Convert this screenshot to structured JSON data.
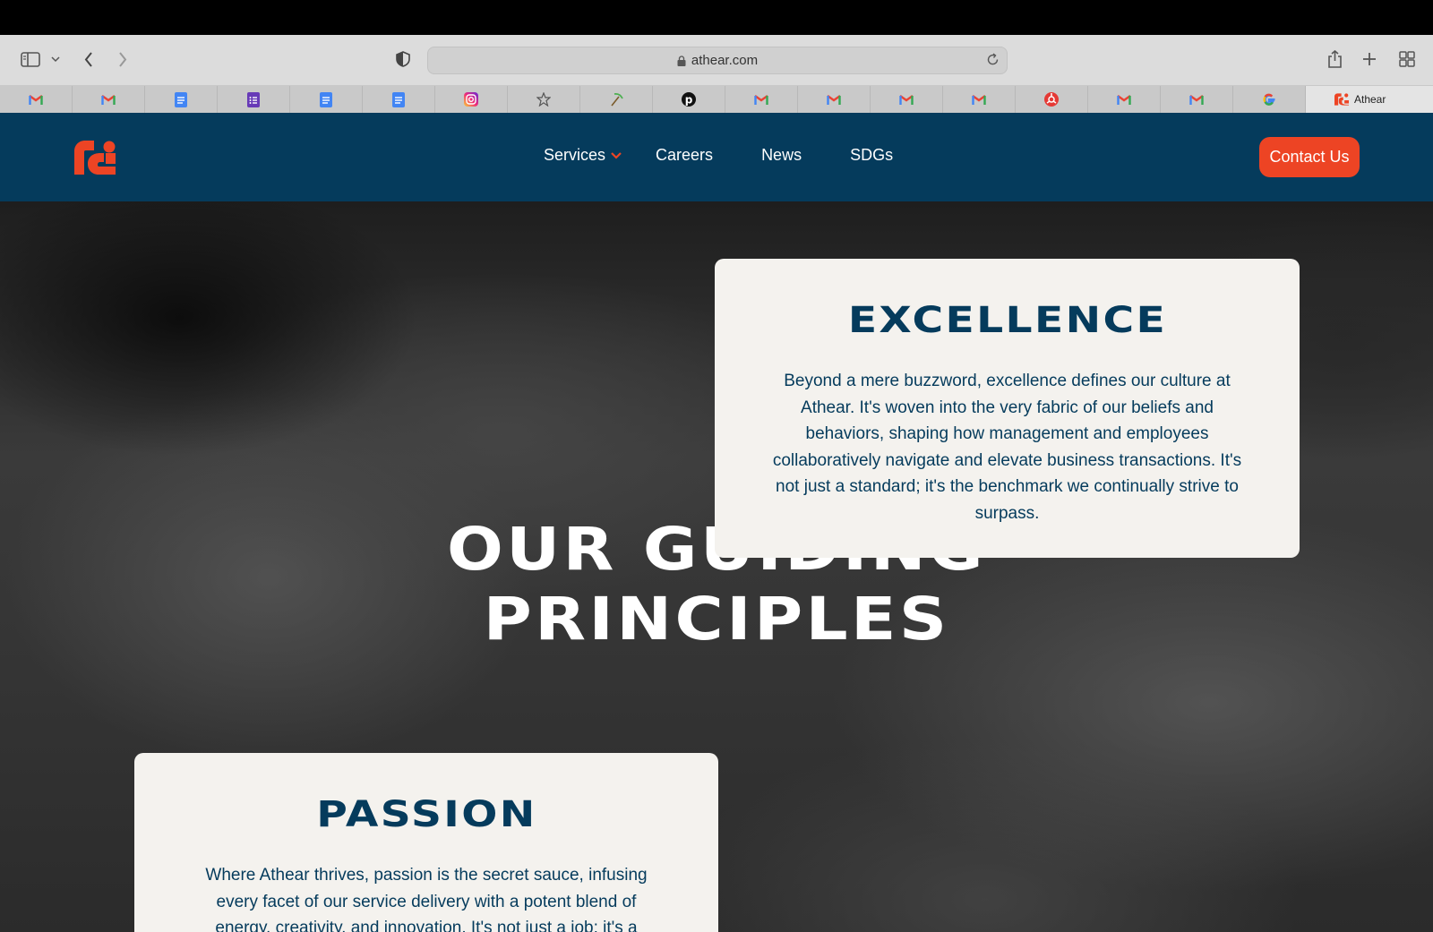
{
  "browser": {
    "url": "athear.com",
    "tabs": [
      {
        "icon": "gmail-icon"
      },
      {
        "icon": "gmail-icon"
      },
      {
        "icon": "google-docs-icon"
      },
      {
        "icon": "google-forms-icon"
      },
      {
        "icon": "google-docs-icon"
      },
      {
        "icon": "google-docs-icon"
      },
      {
        "icon": "instagram-icon"
      },
      {
        "icon": "star-icon"
      },
      {
        "icon": "pickaxe-icon"
      },
      {
        "icon": "pinterest-icon"
      },
      {
        "icon": "gmail-icon"
      },
      {
        "icon": "gmail-icon"
      },
      {
        "icon": "gmail-icon"
      },
      {
        "icon": "gmail-icon"
      },
      {
        "icon": "red-circle-icon"
      },
      {
        "icon": "gmail-icon"
      },
      {
        "icon": "gmail-icon"
      },
      {
        "icon": "google-icon"
      }
    ],
    "active_tab": {
      "title": "Athear",
      "icon": "athear-logo-icon"
    }
  },
  "site": {
    "nav": {
      "services": "Services",
      "careers": "Careers",
      "news": "News",
      "sdgs": "SDGs"
    },
    "contact_label": "Contact Us",
    "hero": {
      "title_line1": "OUR GUIDING",
      "title_line2": "PRINCIPLES"
    },
    "excellence": {
      "title": "EXCELLENCE",
      "body": "Beyond a mere buzzword, excellence defines our culture at Athear. It's woven into the very fabric of our beliefs and behaviors, shaping how management and employees collaboratively navigate and elevate business transactions. It's not just a standard; it's the benchmark we continually strive to surpass."
    },
    "passion": {
      "title": "PASSION",
      "body": "Where Athear thrives, passion is the secret sauce, infusing every facet of our service delivery with a potent blend of energy, creativity, and innovation. It's not just a job; it's a"
    }
  },
  "colors": {
    "header_bg": "#053b5c",
    "accent": "#ed4424",
    "card_bg": "#f4f2ee",
    "card_text": "#053b5c"
  }
}
